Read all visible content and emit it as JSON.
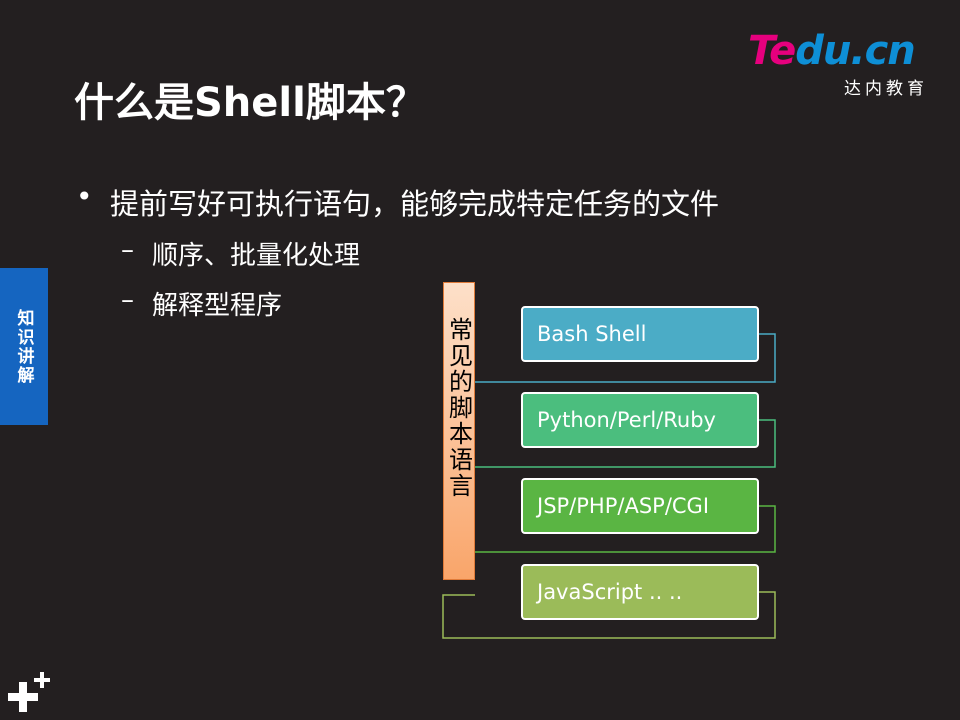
{
  "slide": {
    "title": "什么是Shell脚本？",
    "logo": {
      "brand_a": "Te",
      "brand_b": "du.cn",
      "subtitle": "达内教育"
    },
    "side_tab": "知识讲解",
    "bullet": {
      "text": "提前写好可执行语句，能够完成特定任务的文件",
      "subs": [
        "顺序、批量化处理",
        "解释型程序"
      ]
    }
  },
  "diagram": {
    "category": "常见的脚本语言",
    "items": [
      {
        "label": "Bash Shell",
        "color": "#4bacc6"
      },
      {
        "label": "Python/Perl/Ruby",
        "color": "#4bbe7e"
      },
      {
        "label": "JSP/PHP/ASP/CGI",
        "color": "#5ab543"
      },
      {
        "label": "JavaScript .. ..",
        "color": "#9bbb59"
      }
    ]
  }
}
